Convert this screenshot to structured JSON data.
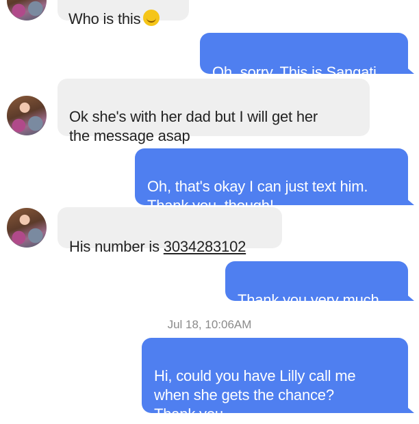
{
  "conversation": {
    "messages": [
      {
        "sender": "contact",
        "text": "Who is this",
        "emoji": "smiling-face-emoji"
      },
      {
        "sender": "me",
        "text": "Oh, sorry. This is Sangati"
      },
      {
        "sender": "contact",
        "text": "Ok she's with her dad but I will get her\nthe message asap"
      },
      {
        "sender": "me",
        "text": "Oh, that's okay I can just text him.\nThank you, though!"
      },
      {
        "sender": "contact",
        "text_prefix": "His number is ",
        "phone": "3034283102"
      },
      {
        "sender": "me",
        "text": "Thank you very much"
      },
      {
        "sender": "me",
        "text": "Hi, could you have Lilly call me\nwhen she gets the chance?\nThank you."
      }
    ],
    "timestamp": "Jul 18, 10:06AM"
  },
  "colors": {
    "outgoing_bubble": "#4f7ff0",
    "incoming_bubble": "#efefef",
    "timestamp_text": "#8a8a8a"
  }
}
